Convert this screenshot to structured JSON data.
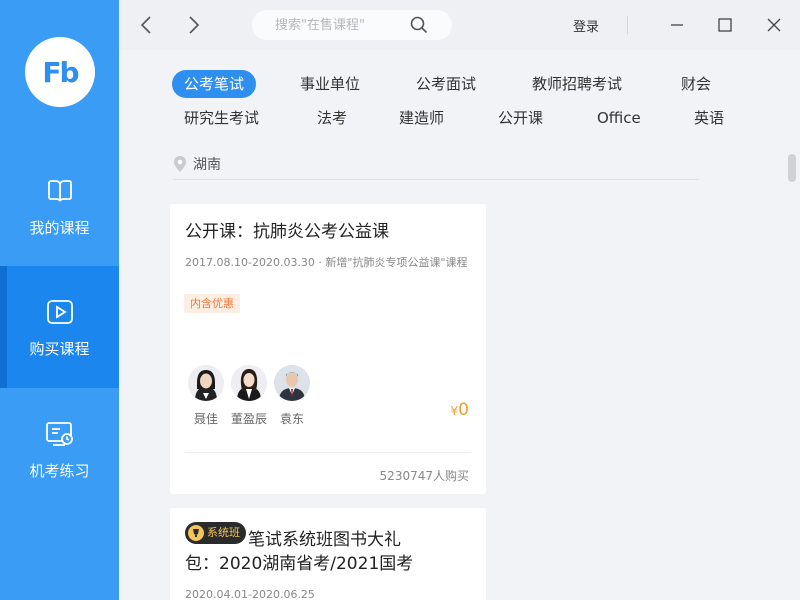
{
  "sidebar": {
    "logo": "Fb",
    "items": [
      {
        "label": "我的课程",
        "icon": "book-icon"
      },
      {
        "label": "购买课程",
        "icon": "play-icon"
      },
      {
        "label": "机考练习",
        "icon": "monitor-clock-icon"
      }
    ]
  },
  "topbar": {
    "search_placeholder": "搜索\"在售课程\"",
    "login_label": "登录"
  },
  "tabs": [
    {
      "label": "公考笔试",
      "active": true
    },
    {
      "label": "事业单位"
    },
    {
      "label": "公考面试"
    },
    {
      "label": "教师招聘考试"
    },
    {
      "label": "财会"
    },
    {
      "label": "研究生考试"
    },
    {
      "label": "法考"
    },
    {
      "label": "建造师"
    },
    {
      "label": "公开课"
    },
    {
      "label": "Office"
    },
    {
      "label": "英语"
    }
  ],
  "location": "湖南",
  "courses": [
    {
      "title": "公开课：抗肺炎公考公益课",
      "date": "2017.08.10-2020.03.30 · 新增\"抗肺炎专项公益课\"课程",
      "badge": "内含优惠",
      "teachers": [
        "聂佳",
        "董盈辰",
        "袁东"
      ],
      "price_symbol": "¥",
      "price_value": "0",
      "buyers": "5230747人购买"
    },
    {
      "class_badge": "系统班",
      "title_line1": "笔试系统班图书大礼",
      "title_line2": "包：2020湖南省考/2021国考",
      "date": "2020.04.01-2020.06.25"
    }
  ],
  "colors": {
    "sidebar": "#3a9cf4",
    "sidebar_active": "#1b86ee",
    "accent": "#2f8ff0",
    "price": "#f0a030"
  }
}
